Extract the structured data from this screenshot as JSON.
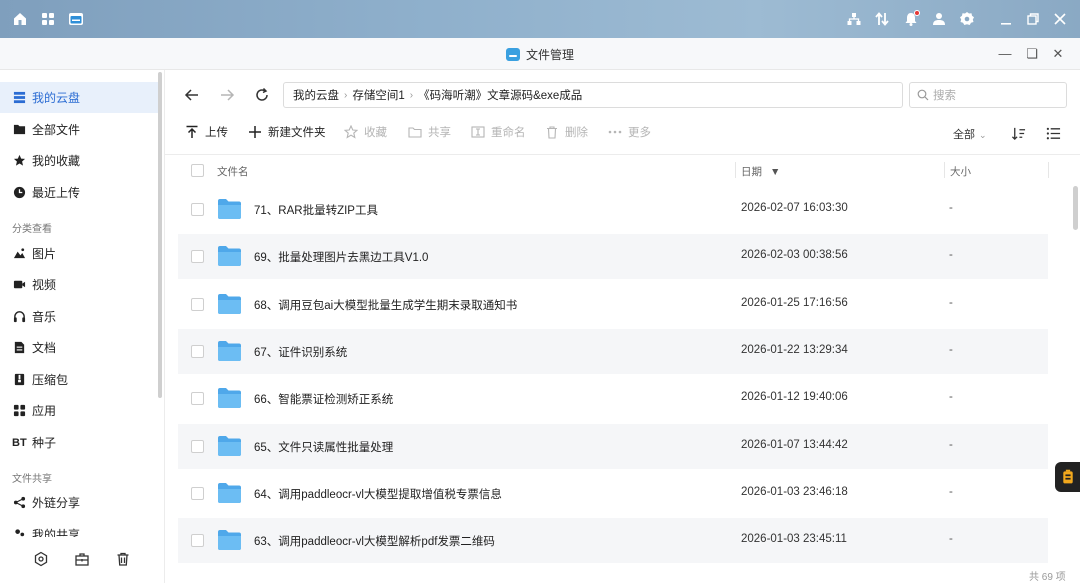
{
  "window": {
    "title": "文件管理"
  },
  "sidebar": {
    "items": [
      {
        "label": "我的云盘",
        "icon": "storage-icon",
        "active": true
      },
      {
        "label": "全部文件",
        "icon": "folder-icon"
      },
      {
        "label": "我的收藏",
        "icon": "star-icon"
      },
      {
        "label": "最近上传",
        "icon": "clock-icon"
      }
    ],
    "section_category": "分类查看",
    "categories": [
      {
        "label": "图片",
        "icon": "image-icon"
      },
      {
        "label": "视频",
        "icon": "video-icon"
      },
      {
        "label": "音乐",
        "icon": "headphones-icon"
      },
      {
        "label": "文档",
        "icon": "document-icon"
      },
      {
        "label": "压缩包",
        "icon": "archive-icon"
      },
      {
        "label": "应用",
        "icon": "apps-icon"
      },
      {
        "label": "种子",
        "icon": "bt-icon",
        "prefix": "BT"
      }
    ],
    "section_share": "文件共享",
    "share_items": [
      {
        "label": "外链分享",
        "icon": "share-icon"
      },
      {
        "label": "我的共享",
        "icon": "shared-icon"
      }
    ]
  },
  "breadcrumb": [
    "我的云盘",
    "存储空间1",
    "《码海听潮》文章源码&exe成品"
  ],
  "search": {
    "placeholder": "搜索"
  },
  "toolbar": {
    "upload": "上传",
    "new_folder": "新建文件夹",
    "favorite": "收藏",
    "share": "共享",
    "rename": "重命名",
    "delete": "删除",
    "more": "更多",
    "filter": "全部"
  },
  "table": {
    "headers": {
      "name": "文件名",
      "date": "日期",
      "size": "大小"
    },
    "rows": [
      {
        "name": "71、RAR批量转ZIP工具",
        "date": "2026-02-07 16:03:30",
        "size": "-"
      },
      {
        "name": "69、批量处理图片去黑边工具V1.0",
        "date": "2026-02-03 00:38:56",
        "size": "-"
      },
      {
        "name": "68、调用豆包ai大模型批量生成学生期末录取通知书",
        "date": "2026-01-25 17:16:56",
        "size": "-"
      },
      {
        "name": "67、证件识别系统",
        "date": "2026-01-22 13:29:34",
        "size": "-"
      },
      {
        "name": "66、智能票证检测矫正系统",
        "date": "2026-01-12 19:40:06",
        "size": "-"
      },
      {
        "name": "65、文件只读属性批量处理",
        "date": "2026-01-07 13:44:42",
        "size": "-"
      },
      {
        "name": "64、调用paddleocr-vl大模型提取增值税专票信息",
        "date": "2026-01-03 23:46:18",
        "size": "-"
      },
      {
        "name": "63、调用paddleocr-vl大模型解析pdf发票二维码",
        "date": "2026-01-03 23:45:11",
        "size": "-"
      }
    ]
  },
  "footer": {
    "count": "共 69 项"
  },
  "colors": {
    "accent": "#2b6cd3",
    "folder": "#5fb3ee",
    "active_bg": "#e8f0fb"
  }
}
